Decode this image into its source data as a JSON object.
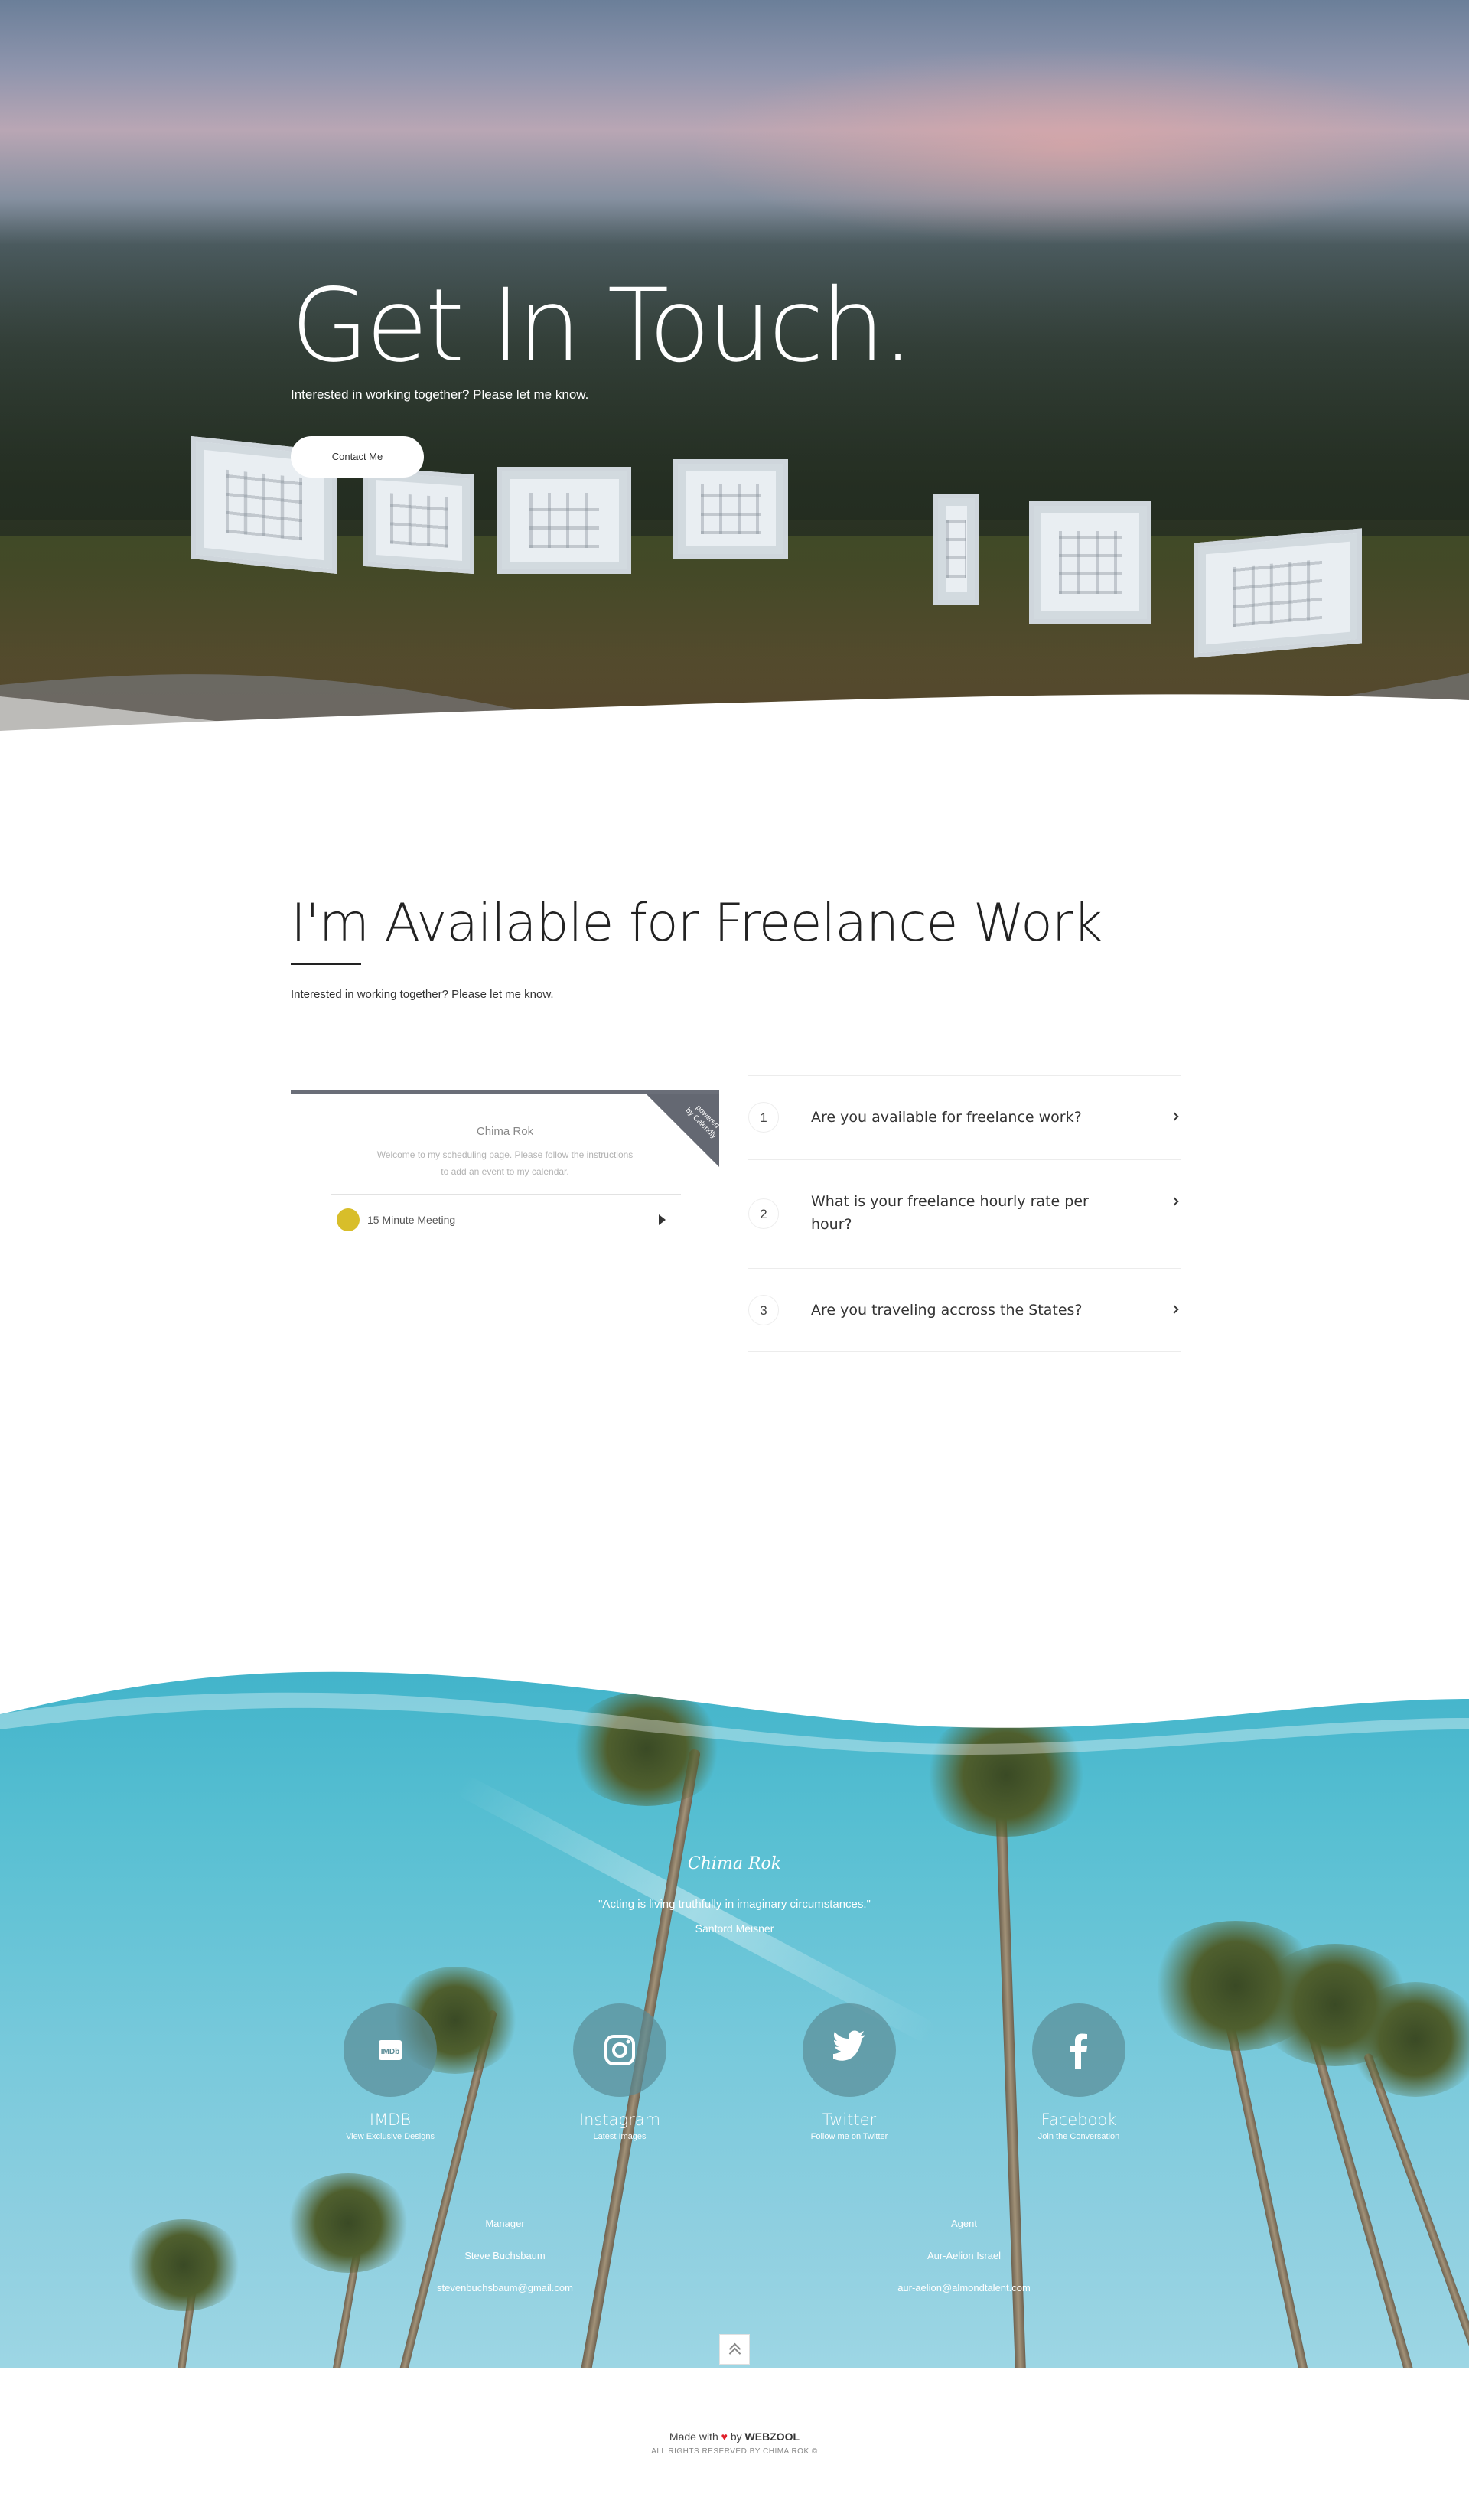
{
  "hero": {
    "title": "Get In Touch.",
    "subtitle": "Interested in working together? Please let me know.",
    "button_label": "Contact Me"
  },
  "freelance": {
    "title": "I'm Available for Freelance Work",
    "subtitle": "Interested in working together? Please let me know."
  },
  "scheduler": {
    "name": "Chima Rok",
    "description": "Welcome to my scheduling page. Please follow the instructions to add an event to my calendar.",
    "event_label": "15 Minute Meeting",
    "event_color": "#d8be2a",
    "badge_line1": "powered",
    "badge_line2": "by Calendly"
  },
  "faq": [
    {
      "number": "1",
      "question": "Are you available for freelance work?"
    },
    {
      "number": "2",
      "question": "What is your freelance hourly rate per hour?"
    },
    {
      "number": "3",
      "question": "Are you traveling accross the States?"
    }
  ],
  "footer": {
    "signature": "Chima Rok",
    "quote": "\"Acting is living truthfully in imaginary circumstances.\"",
    "quote_author": "Sanford Meisner",
    "social": [
      {
        "icon": "imdb-icon",
        "name": "IMDB",
        "caption": "View Exclusive Designs"
      },
      {
        "icon": "instagram-icon",
        "name": "Instagram",
        "caption": "Latest Images"
      },
      {
        "icon": "twitter-icon",
        "name": "Twitter",
        "caption": "Follow me on Twitter"
      },
      {
        "icon": "facebook-icon",
        "name": "Facebook",
        "caption": "Join the Conversation"
      }
    ],
    "manager": {
      "label": "Manager",
      "name": "Steve Buchsbaum",
      "email": "stevenbuchsbaum@gmail.com"
    },
    "agent": {
      "label": "Agent",
      "name": "Aur-Aelion Israel",
      "email": "aur-aelion@almondtalent.com"
    },
    "made_prefix": "Made with",
    "made_by": "by",
    "brand": "WEBZOOL",
    "rights": "ALL RIGHTS RESERVED BY CHIMA ROK ©"
  }
}
